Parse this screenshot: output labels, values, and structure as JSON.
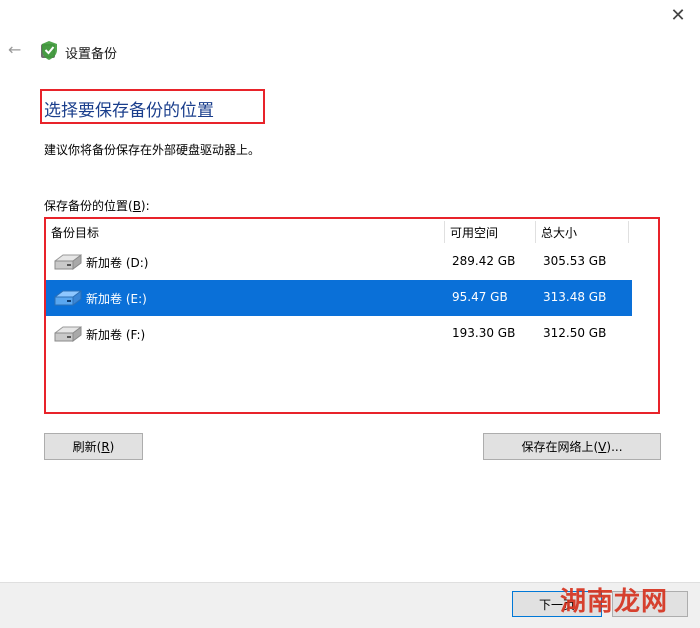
{
  "window": {
    "title": "设置备份",
    "close_glyph": "✕",
    "back_glyph": "←"
  },
  "heading": "选择要保存备份的位置",
  "description": "建议你将备份保存在外部硬盘驱动器上。",
  "list_label": "保存备份的位置(B):",
  "list": {
    "columns": [
      "备份目标",
      "可用空间",
      "总大小"
    ],
    "rows": [
      {
        "name": "新加卷 (D:)",
        "free": "289.42 GB",
        "total": "305.53 GB",
        "selected": false
      },
      {
        "name": "新加卷 (E:)",
        "free": "95.47 GB",
        "total": "313.48 GB",
        "selected": true
      },
      {
        "name": "新加卷 (F:)",
        "free": "193.30 GB",
        "total": "312.50 GB",
        "selected": false
      }
    ]
  },
  "buttons": {
    "refresh": "刷新(R)",
    "save_network": "保存在网络上(V)...",
    "next": "下一页",
    "cancel": ""
  },
  "watermark": "湖南龙网",
  "icons": {
    "app": "backup-shield-icon",
    "drive": "hard-drive-icon"
  },
  "colors": {
    "selection": "#0a70d8",
    "highlight_box": "#e8232a",
    "heading": "#1a3e8c"
  }
}
